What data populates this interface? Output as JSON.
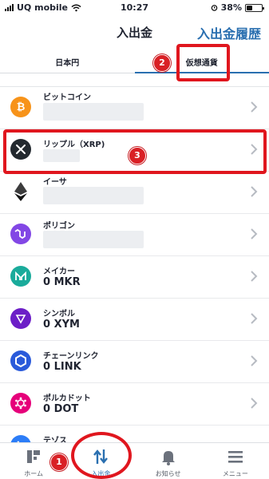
{
  "status_bar": {
    "carrier": "UQ mobile",
    "time": "10:27",
    "battery": "38%",
    "battery_level": 0.38
  },
  "header": {
    "title": "入出金",
    "history_link": "入出金履歴"
  },
  "tabs": [
    {
      "label": "日本円",
      "active": false
    },
    {
      "label": "仮想通貨",
      "active": true
    }
  ],
  "coins": [
    {
      "name": "ビットコイン",
      "balance": "",
      "icon": "bitcoin-icon",
      "color": "#f7931a"
    },
    {
      "name": "リップル（XRP)",
      "balance": "",
      "icon": "xrp-icon",
      "color": "#23292f"
    },
    {
      "name": "イーサ",
      "balance": "",
      "icon": "ethereum-icon",
      "color": "#3c3c3d"
    },
    {
      "name": "ポリゴン",
      "balance": "",
      "icon": "polygon-icon",
      "color": "#8247e5"
    },
    {
      "name": "メイカー",
      "balance": "0 MKR",
      "icon": "maker-icon",
      "color": "#1aab9b"
    },
    {
      "name": "シンボル",
      "balance": "0 XYM",
      "icon": "symbol-icon",
      "color": "#6c1ec7"
    },
    {
      "name": "チェーンリンク",
      "balance": "0 LINK",
      "icon": "chainlink-icon",
      "color": "#2a5ada"
    },
    {
      "name": "ポルカドット",
      "balance": "0 DOT",
      "icon": "polkadot-icon",
      "color": "#e6007a"
    },
    {
      "name": "テゾス",
      "balance": "",
      "icon": "tezos-icon",
      "color": "#2c7df7"
    }
  ],
  "annotations": {
    "step1": "1",
    "step2": "2",
    "step3": "3"
  },
  "nav": [
    {
      "label": "ホーム",
      "icon": "home-icon"
    },
    {
      "label": "入出金",
      "icon": "transfer-icon"
    },
    {
      "label": "お知らせ",
      "icon": "bell-icon"
    },
    {
      "label": "メニュー",
      "icon": "menu-icon"
    }
  ],
  "colors": {
    "accent": "#2a6fb0",
    "annotation": "#e0161e"
  }
}
